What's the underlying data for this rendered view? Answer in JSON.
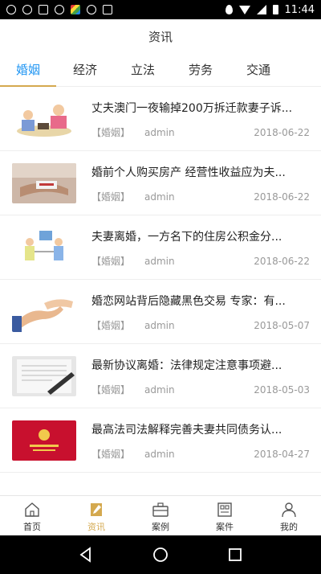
{
  "status_bar": {
    "time": "11:44"
  },
  "header": {
    "title": "资讯"
  },
  "tabs": [
    {
      "label": "婚姻"
    },
    {
      "label": "经济"
    },
    {
      "label": "立法"
    },
    {
      "label": "劳务"
    },
    {
      "label": "交通"
    }
  ],
  "news": [
    {
      "title": "丈夫澳门一夜输掉200万拆迁款妻子诉...",
      "category": "【婚姻】",
      "author": "admin",
      "date": "2018-06-22"
    },
    {
      "title": "婚前个人购买房产 经营性收益应为夫...",
      "category": "【婚姻】",
      "author": "admin",
      "date": "2018-06-22"
    },
    {
      "title": "夫妻离婚，一方名下的住房公积金分...",
      "category": "【婚姻】",
      "author": "admin",
      "date": "2018-06-22"
    },
    {
      "title": "婚恋网站背后隐藏黑色交易 专家：有...",
      "category": "【婚姻】",
      "author": "admin",
      "date": "2018-05-07"
    },
    {
      "title": "最新协议离婚：法律规定注意事项避...",
      "category": "【婚姻】",
      "author": "admin",
      "date": "2018-05-03"
    },
    {
      "title": "最高法司法解释完善夫妻共同债务认...",
      "category": "【婚姻】",
      "author": "admin",
      "date": "2018-04-27"
    }
  ],
  "bottom_nav": [
    {
      "label": "首页",
      "icon": "home-icon"
    },
    {
      "label": "资讯",
      "icon": "news-icon"
    },
    {
      "label": "案例",
      "icon": "briefcase-icon"
    },
    {
      "label": "案件",
      "icon": "case-file-icon"
    },
    {
      "label": "我的",
      "icon": "user-icon"
    }
  ],
  "colors": {
    "accent": "#d4a94f",
    "tab_active": "#2196f3"
  }
}
